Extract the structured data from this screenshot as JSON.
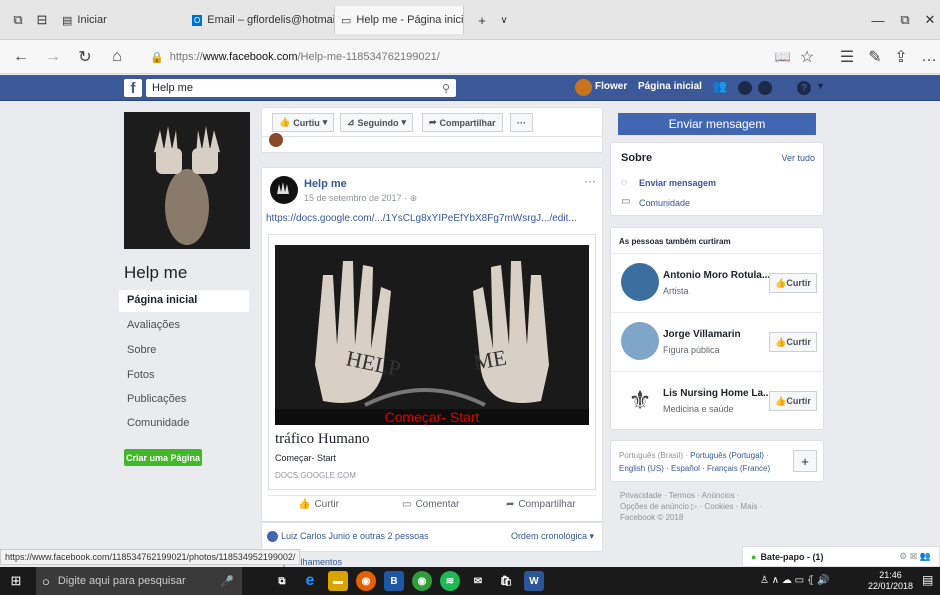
{
  "browser": {
    "tab1": "Iniciar",
    "tab2": "Email – gflordelis@hotmail.",
    "tab3": "Help me - Página inicial",
    "url_prefix": "https://",
    "url_domain": "www.facebook.com",
    "url_path": "/Help-me-118534762199021/"
  },
  "fb": {
    "search": "Help me",
    "user": "Flower",
    "home": "Página inicial",
    "brand_color": "#3b5998"
  },
  "left": {
    "page_name": "Help me",
    "nav": [
      "Página inicial",
      "Avaliações",
      "Sobre",
      "Fotos",
      "Publicações",
      "Comunidade"
    ],
    "create": "Criar uma Página"
  },
  "actions": {
    "liked": "Curtiu",
    "following": "Seguindo",
    "share": "Compartilhar",
    "more": "···"
  },
  "post": {
    "author": "Help me",
    "date": "15 de setembro de 2017 · ",
    "link": "https://docs.google.com/.../1YsCLg8xYIPeEfYbX8Fg7mWsrgJ.../edit...",
    "image_word1": "HELP",
    "image_word2": "ME",
    "image_banner": "Começar- Start",
    "link_title": "tráfico Humano",
    "link_desc": "Começar- Start",
    "link_domain": "DOCS.GOOGLE.COM",
    "like": "Curtir",
    "comment": "Comentar",
    "share": "Compartilhar",
    "reactions": "Luiz Carlos Junio e outras 2 pessoas",
    "order": "Ordem cronológica ▾",
    "shares": "compartilhamentos"
  },
  "right": {
    "message": "Enviar mensagem",
    "about_title": "Sobre",
    "see_all": "Ver tudo",
    "about_msg": "Enviar mensagem",
    "about_comm": "Comunidade",
    "likes_title": "As pessoas também curtiram",
    "likers": [
      {
        "name": "Antonio Moro Rotula...",
        "type": "Artista",
        "btn": "Curtir"
      },
      {
        "name": "Jorge Villamarin",
        "type": "Figura pública",
        "btn": "Curtir"
      },
      {
        "name": "Lis Nursing Home La...",
        "type": "Medicina e saúde",
        "btn": "Curtir"
      }
    ],
    "langs_line1": "Português (Brasil) · ",
    "langs_sel": "Português (Portugal)",
    "langs_line1_end": " ·",
    "langs_line2": "English (US) · Español · Français (France)",
    "plus": "+",
    "footer1": "Privacidade · Termos · Anúncios ·",
    "footer2": "Opções de anúncio ▷ · Cookies · Mais ·",
    "footer3": "Facebook © 2018",
    "chat": "Bate-papo - (1)"
  },
  "status_url": "https://www.facebook.com/118534762199021/photos/118534952199002/",
  "taskbar": {
    "search": "Digite aqui para pesquisar",
    "time": "21:46",
    "date": "22/01/2018"
  }
}
